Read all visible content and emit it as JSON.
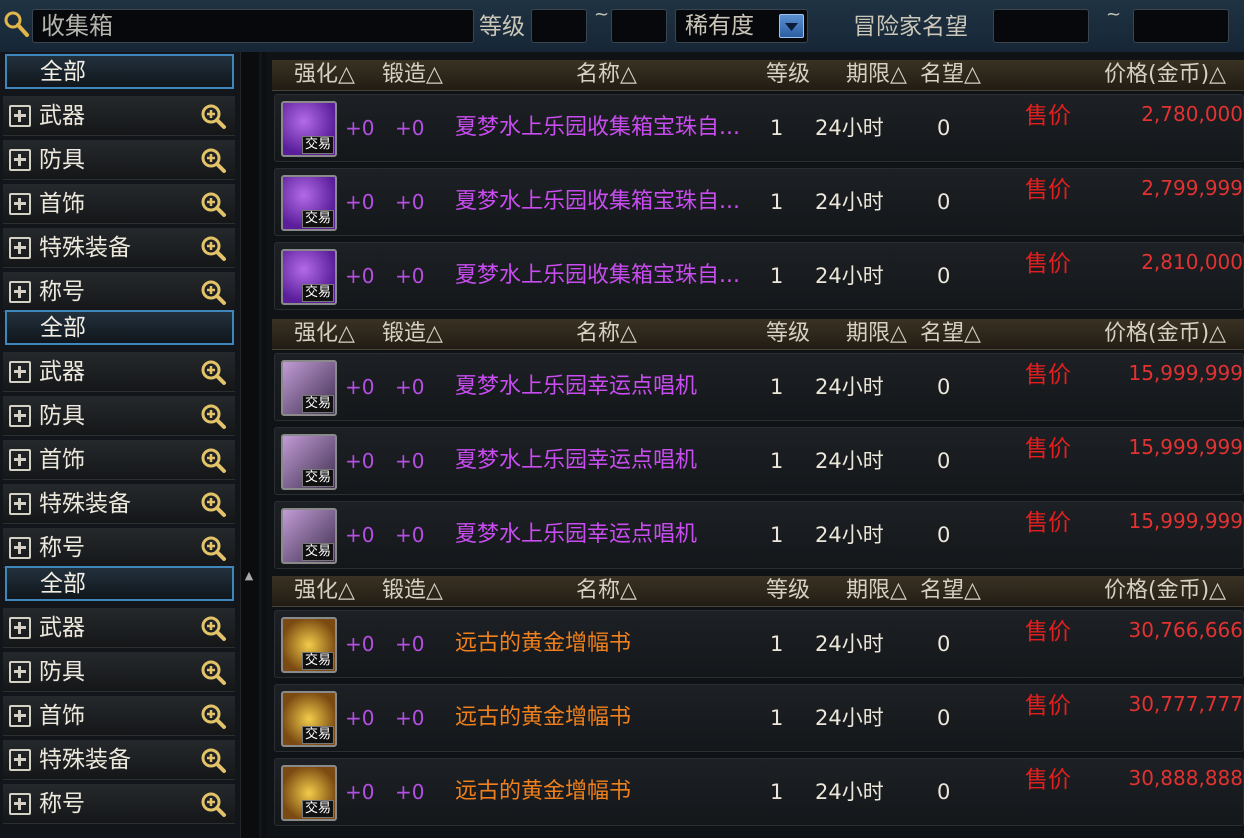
{
  "search": {
    "value": "收集箱"
  },
  "filters": {
    "level_label": "等级",
    "level_min": "",
    "level_sep": "~",
    "level_max": "",
    "rarity_selected": "稀有度",
    "reputation_label": "冒险家名望",
    "reputation_min": "",
    "reputation_sep": "~",
    "reputation_max": ""
  },
  "sidebar": {
    "groups": [
      {
        "all": "全部",
        "items": [
          "武器",
          "防具",
          "首饰",
          "特殊装备",
          "称号"
        ]
      },
      {
        "all": "全部",
        "items": [
          "武器",
          "防具",
          "首饰",
          "特殊装备",
          "称号"
        ]
      },
      {
        "all": "全部",
        "items": [
          "武器",
          "防具",
          "首饰",
          "特殊装备",
          "称号"
        ]
      }
    ]
  },
  "columns": {
    "enhance": "强化△",
    "forge": "锻造△",
    "name": "名称△",
    "level": "等级",
    "expiry": "期限△",
    "reputation": "名望△",
    "price": "价格(金币)△"
  },
  "sections": [
    {
      "rows": [
        {
          "enh": "+0",
          "forge": "+0",
          "name": "夏梦水上乐园收集箱宝珠自...",
          "level": "1",
          "expiry": "24小时",
          "rep": "0",
          "sell": "售价",
          "price": "2,780,000",
          "tag": "交易"
        },
        {
          "enh": "+0",
          "forge": "+0",
          "name": "夏梦水上乐园收集箱宝珠自...",
          "level": "1",
          "expiry": "24小时",
          "rep": "0",
          "sell": "售价",
          "price": "2,799,999",
          "tag": "交易"
        },
        {
          "enh": "+0",
          "forge": "+0",
          "name": "夏梦水上乐园收集箱宝珠自...",
          "level": "1",
          "expiry": "24小时",
          "rep": "0",
          "sell": "售价",
          "price": "2,810,000",
          "tag": "交易"
        }
      ]
    },
    {
      "rows": [
        {
          "enh": "+0",
          "forge": "+0",
          "name": "夏梦水上乐园幸运点唱机",
          "level": "1",
          "expiry": "24小时",
          "rep": "0",
          "sell": "售价",
          "price": "15,999,999",
          "tag": "交易"
        },
        {
          "enh": "+0",
          "forge": "+0",
          "name": "夏梦水上乐园幸运点唱机",
          "level": "1",
          "expiry": "24小时",
          "rep": "0",
          "sell": "售价",
          "price": "15,999,999",
          "tag": "交易"
        },
        {
          "enh": "+0",
          "forge": "+0",
          "name": "夏梦水上乐园幸运点唱机",
          "level": "1",
          "expiry": "24小时",
          "rep": "0",
          "sell": "售价",
          "price": "15,999,999",
          "tag": "交易"
        }
      ]
    },
    {
      "rows": [
        {
          "enh": "+0",
          "forge": "+0",
          "name": "远古的黄金增幅书",
          "level": "1",
          "expiry": "24小时",
          "rep": "0",
          "sell": "售价",
          "price": "30,766,666",
          "tag": "交易"
        },
        {
          "enh": "+0",
          "forge": "+0",
          "name": "远古的黄金增幅书",
          "level": "1",
          "expiry": "24小时",
          "rep": "0",
          "sell": "售价",
          "price": "30,777,777",
          "tag": "交易"
        },
        {
          "enh": "+0",
          "forge": "+0",
          "name": "远古的黄金增幅书",
          "level": "1",
          "expiry": "24小时",
          "rep": "0",
          "sell": "售价",
          "price": "30,888,888",
          "tag": "交易"
        }
      ]
    }
  ],
  "colors": {
    "name_purple": "#c84cf0",
    "name_orange": "#f0801c",
    "price_red": "#e23232",
    "selection_blue": "#3f86bd"
  },
  "icons": {
    "search": "magnifier-icon",
    "expand": "plus-box-icon",
    "zoom": "zoom-in-icon",
    "dropdown": "chevron-down-icon"
  }
}
